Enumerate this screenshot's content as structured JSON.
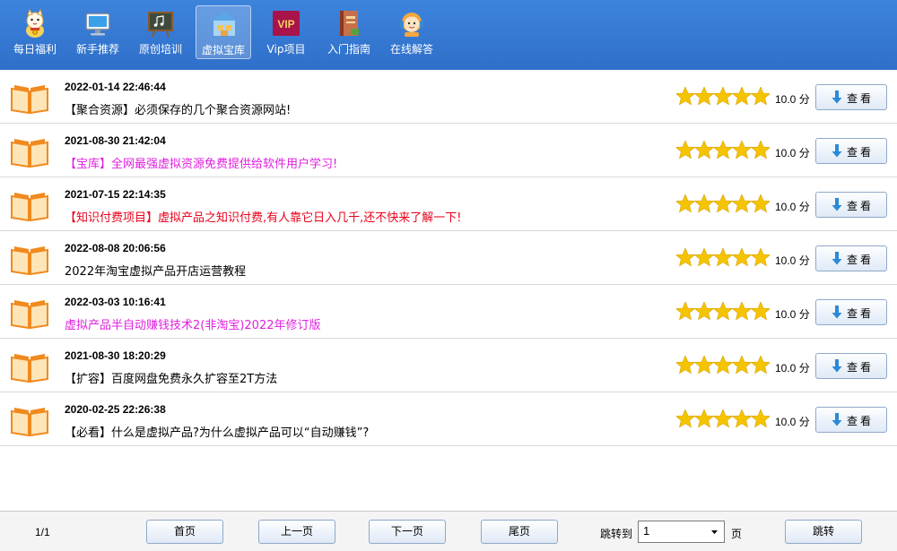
{
  "toolbar": {
    "items": [
      {
        "label": "每日福利",
        "icon": "lucky-cat-icon"
      },
      {
        "label": "新手推荐",
        "icon": "monitor-icon"
      },
      {
        "label": "原创培训",
        "icon": "chalkboard-icon"
      },
      {
        "label": "虚拟宝库",
        "icon": "warehouse-icon",
        "active": true
      },
      {
        "label": "Vip项目",
        "icon": "vip-badge-icon",
        "badge": "VIP"
      },
      {
        "label": "入门指南",
        "icon": "guide-book-icon"
      },
      {
        "label": "在线解答",
        "icon": "customer-service-icon"
      }
    ]
  },
  "list": {
    "rows": [
      {
        "date": "2022-01-14 22:46:44",
        "title": "【聚合资源】必须保存的几个聚合资源网站!",
        "color": "#000000",
        "score": "10.0 分",
        "button": "查看"
      },
      {
        "date": "2021-08-30 21:42:04",
        "title": "【宝库】全网最强虚拟资源免费提供给软件用户学习!",
        "color": "#e020e0",
        "score": "10.0 分",
        "button": "查看"
      },
      {
        "date": "2021-07-15 22:14:35",
        "title": "【知识付费项目】虚拟产品之知识付费,有人靠它日入几千,还不快来了解一下!",
        "color": "#e8001a",
        "score": "10.0 分",
        "button": "查看"
      },
      {
        "date": "2022-08-08 20:06:56",
        "title": "2022年淘宝虚拟产品开店运营教程",
        "color": "#000000",
        "score": "10.0 分",
        "button": "查看"
      },
      {
        "date": "2022-03-03 10:16:41",
        "title": "虚拟产品半自动赚钱技术2(非淘宝)2022年修订版",
        "color": "#e020e0",
        "score": "10.0 分",
        "button": "查看"
      },
      {
        "date": "2021-08-30 18:20:29",
        "title": "【扩容】百度网盘免费永久扩容至2T方法",
        "color": "#000000",
        "score": "10.0 分",
        "button": "查看"
      },
      {
        "date": "2020-02-25 22:26:38",
        "title": "【必看】什么是虚拟产品?为什么虚拟产品可以“自动赚钱”?",
        "color": "#000000",
        "score": "10.0 分",
        "button": "查看"
      }
    ]
  },
  "footer": {
    "page_info": "1/1",
    "first": "首页",
    "prev": "上一页",
    "next": "下一页",
    "last": "尾页",
    "jump_label": "跳转到",
    "jump_value": "1",
    "page_unit": "页",
    "jump_button": "跳转"
  },
  "colors": {
    "toolbar_bg": "#3479d6",
    "star": "#f5c400",
    "book": "#f08a1e"
  }
}
